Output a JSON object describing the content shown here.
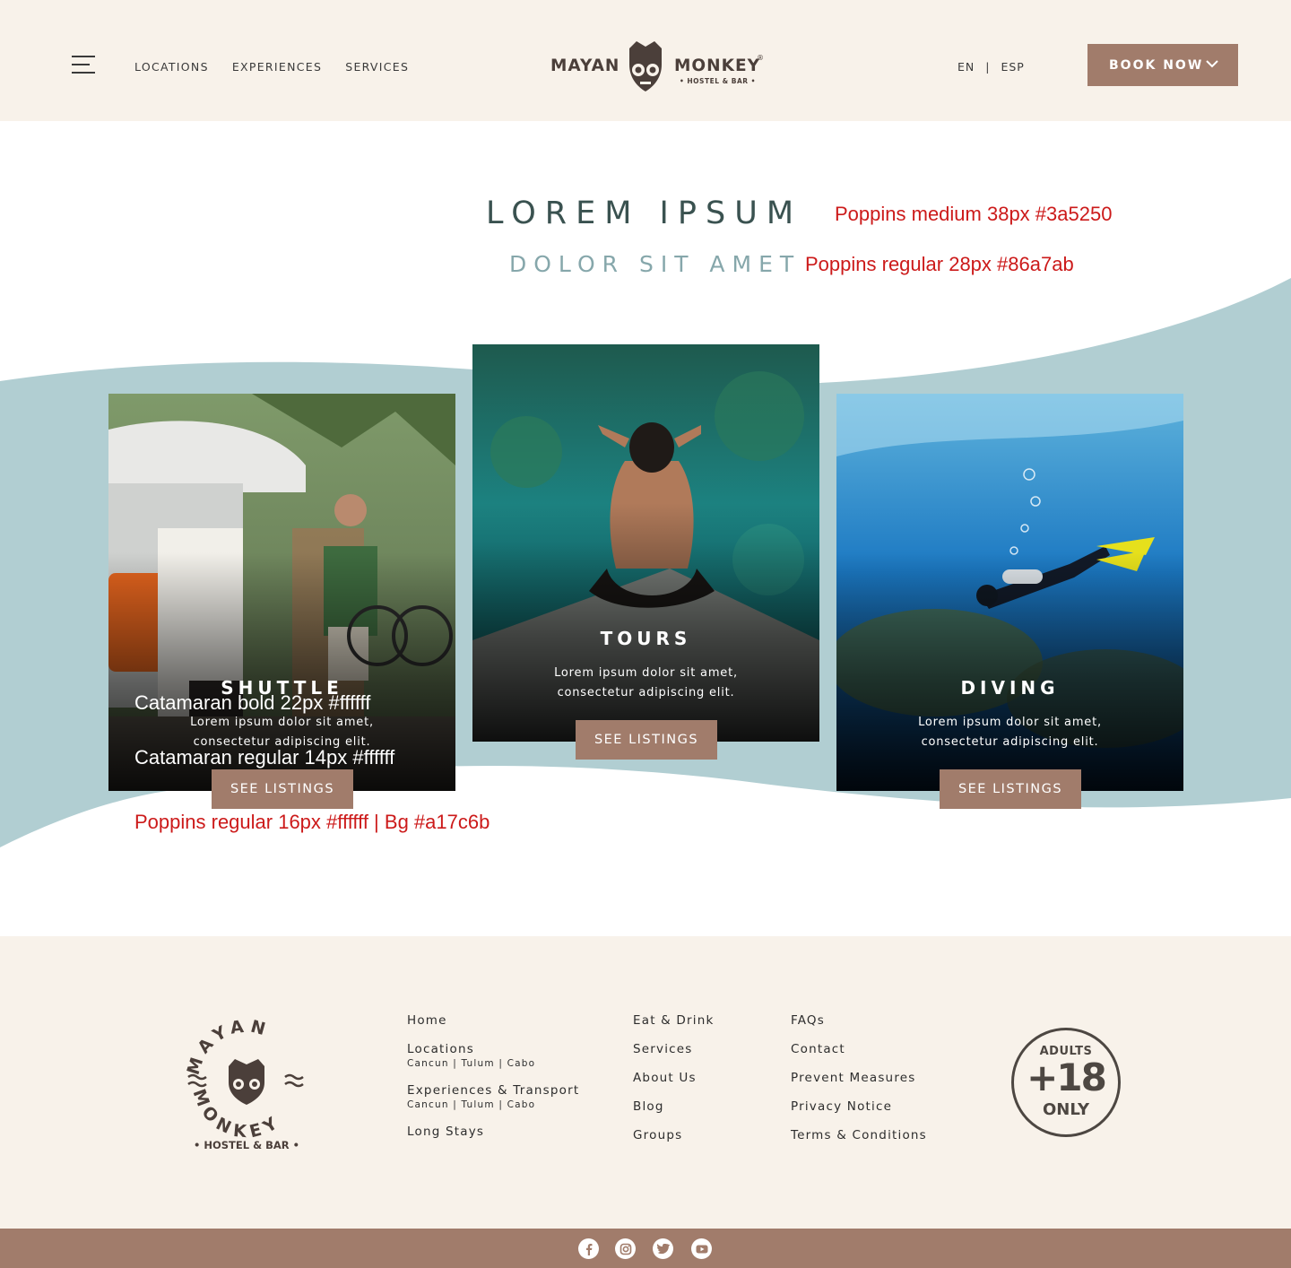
{
  "header": {
    "nav": [
      "LOCATIONS",
      "EXPERIENCES",
      "SERVICES"
    ],
    "logo": {
      "left": "MAYAN",
      "right": "MONKEY",
      "reg": "®",
      "sub": "• HOSTEL & BAR •"
    },
    "lang": {
      "en": "EN",
      "sep": "|",
      "esp": "ESP"
    },
    "book_label": "BOOK NOW"
  },
  "hero": {
    "title": "LOREM IPSUM",
    "subtitle": "DOLOR SIT AMET"
  },
  "annotations": {
    "title_spec": "Poppins medium 38px #3a5250",
    "subtitle_spec": "Poppins regular 28px #86a7ab",
    "card_title_spec": "Catamaran bold 22px #ffffff",
    "card_desc_spec": "Catamaran regular 14px #ffffff",
    "button_spec": "Poppins regular 16px #ffffff | Bg #a17c6b"
  },
  "cards": [
    {
      "title": "SHUTTLE",
      "desc": "Lorem ipsum dolor sit amet, consectetur adipiscing elit.",
      "button": "SEE LISTINGS"
    },
    {
      "title": "TOURS",
      "desc": "Lorem ipsum dolor sit amet, consectetur adipiscing elit.",
      "button": "SEE LISTINGS"
    },
    {
      "title": "DIVING",
      "desc": "Lorem ipsum dolor sit amet, consectetur adipiscing elit.",
      "button": "SEE LISTINGS"
    }
  ],
  "footer": {
    "logo": {
      "top": "MAYAN",
      "bottom": "MONKEY",
      "sub": "• HOSTEL & BAR •"
    },
    "col1": {
      "home": "Home",
      "locations": "Locations",
      "locations_sub": "Cancun | Tulum | Cabo",
      "experiences": "Experiences & Transport",
      "experiences_sub": "Cancun | Tulum | Cabo",
      "long_stays": "Long Stays"
    },
    "col2": [
      "Eat & Drink",
      "Services",
      "About Us",
      "Blog",
      "Groups"
    ],
    "col3": [
      "FAQs",
      "Contact",
      "Prevent Measures",
      "Privacy Notice",
      "Terms & Conditions"
    ],
    "adults": {
      "top": "ADULTS",
      "big": "+18",
      "bottom": "ONLY"
    }
  },
  "social": [
    "facebook-icon",
    "instagram-icon",
    "twitter-icon",
    "youtube-icon"
  ],
  "colors": {
    "brand": "#a17c6b",
    "heading": "#3a5250",
    "subheading": "#86a7ab",
    "wave": "#b1ced2",
    "cream": "#f8f2ea"
  }
}
